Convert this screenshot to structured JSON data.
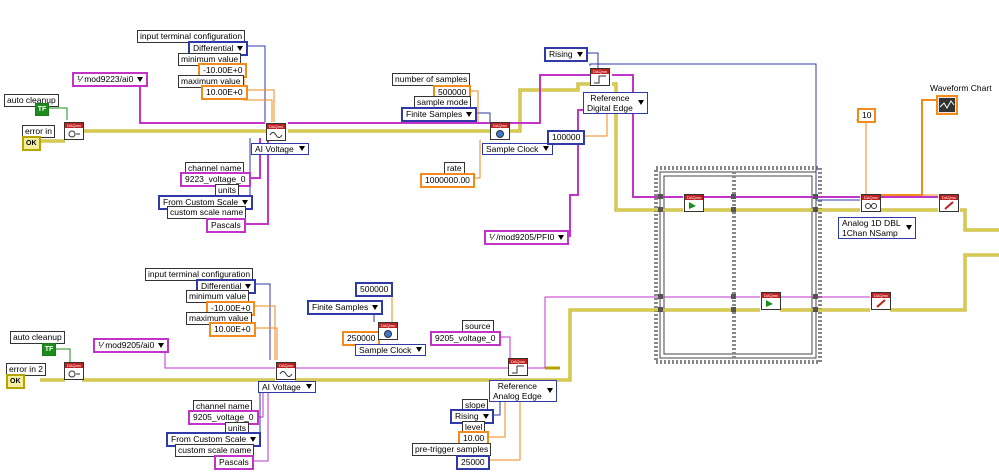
{
  "top_task": {
    "input_terminal_configuration_label": "input terminal configuration",
    "input_terminal_configuration_value": "Differential",
    "minimum_value_label": "minimum value",
    "minimum_value": "-10.00E+0",
    "maximum_value_label": "maximum value",
    "maximum_value": "10.00E+0",
    "physical_channel": "mod9223/ai0",
    "auto_cleanup_label": "auto cleanup",
    "auto_cleanup_value": "TF",
    "error_in_label": "error in",
    "error_in_value": "OK",
    "ai_voltage_selector": "AI Voltage",
    "channel_name_label": "channel name",
    "channel_name_value": "9223_voltage_0",
    "units_label": "units",
    "units_value": "From Custom Scale",
    "custom_scale_name_label": "custom scale name",
    "custom_scale_name_value": "Pascals",
    "number_of_samples_label": "number of samples",
    "number_of_samples_value": "500000",
    "sample_mode_label": "sample mode",
    "sample_mode_value": "Finite Samples",
    "sample_clock_selector": "Sample Clock",
    "rate_label": "rate",
    "rate_value": "1000000.00",
    "trigger_slope_value": "Rising",
    "reference_trigger_selector_line1": "Reference",
    "reference_trigger_selector_line2": "Digital Edge",
    "pretrigger_value": "100000",
    "trigger_source": "/mod9205/PFI0",
    "read_count_value": "10",
    "read_selector_line1": "Analog 1D DBL",
    "read_selector_line2": "1Chan NSamp",
    "waveform_chart_label": "Waveform Chart"
  },
  "bottom_task": {
    "input_terminal_configuration_label": "input terminal configuration",
    "input_terminal_configuration_value": "Differential",
    "minimum_value_label": "minimum value",
    "minimum_value": "-10.00E+0",
    "maximum_value_label": "maximum value",
    "maximum_value": "10.00E+0",
    "physical_channel": "mod9205/ai0",
    "auto_cleanup_label": "auto cleanup",
    "auto_cleanup_value": "TF",
    "error_in_label": "error in 2",
    "error_in_value": "OK",
    "ai_voltage_selector": "AI Voltage",
    "channel_name_label": "channel name",
    "channel_name_value": "9205_voltage_0",
    "units_label": "units",
    "units_value": "From Custom Scale",
    "custom_scale_name_label": "custom scale name",
    "custom_scale_name_value": "Pascals",
    "number_of_samples_value": "500000",
    "sample_mode_value": "Finite Samples",
    "rate_value": "250000",
    "sample_clock_selector": "Sample Clock",
    "source_label": "source",
    "source_value": "9205_voltage_0",
    "reference_trigger_selector_line1": "Reference",
    "reference_trigger_selector_line2": "Analog Edge",
    "slope_label": "slope",
    "slope_value": "Rising",
    "level_label": "level",
    "level_value": "10.00",
    "pretrigger_label": "pre-trigger samples",
    "pretrigger_value": "25000"
  },
  "colors": {
    "resource_wire": "#c234c9",
    "error_wire": "#b7a400",
    "numeric_wire": "#f28a1c",
    "enum_wire": "#2f3aa8",
    "boolean_wire": "#1c8d1c"
  },
  "icons": [
    "daqmx-create-channel-icon",
    "daqmx-timing-icon",
    "daqmx-trigger-icon",
    "daqmx-start-icon",
    "daqmx-read-icon",
    "daqmx-clear-icon",
    "waveform-chart-icon",
    "io-constant-icon"
  ]
}
